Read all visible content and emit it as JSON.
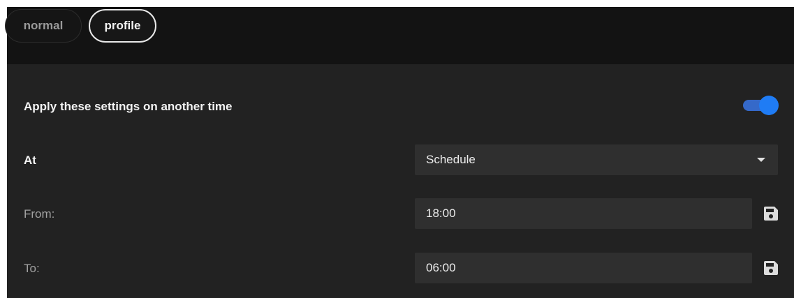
{
  "tabs": [
    {
      "label": "normal",
      "active": false
    },
    {
      "label": "profile",
      "active": true
    }
  ],
  "schedule": {
    "apply_label": "Apply these settings on another time",
    "apply_enabled": true,
    "at_label": "At",
    "at_value": "Schedule",
    "from_label": "From:",
    "from_value": "18:00",
    "to_label": "To:",
    "to_value": "06:00"
  },
  "colors": {
    "background": "#222222",
    "tabbar": "#131313",
    "field": "#2f2f2f",
    "toggle_accent": "#1f7cf5"
  },
  "icons": {
    "save": "floppy-disk-icon",
    "dropdown": "caret-down-icon"
  }
}
